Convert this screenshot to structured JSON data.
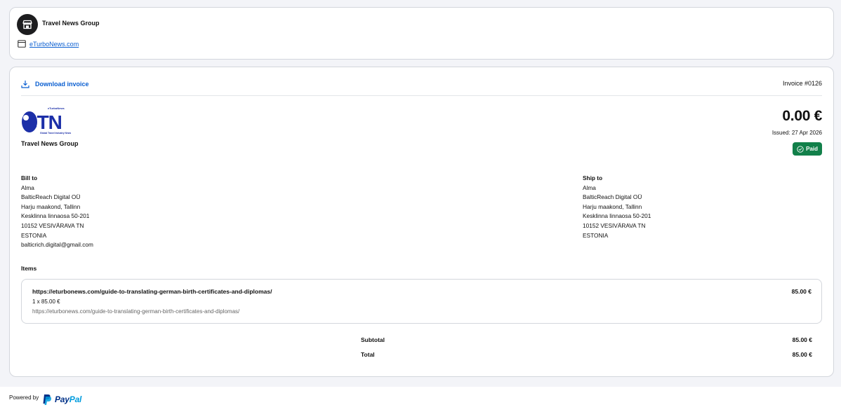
{
  "merchant": {
    "name": "Travel News Group",
    "website": "eTurboNews.com"
  },
  "invoice": {
    "download_label": "Download invoice",
    "number": "Invoice #0126",
    "logo_text": "eTN",
    "logo_top_text": "eTurboNews",
    "logo_tagline": "Global Travel Industry News",
    "company_name": "Travel News Group",
    "amount": "0.00 €",
    "issued": "Issued: 27 Apr 2026",
    "status": "Paid"
  },
  "bill_to": {
    "heading": "Bill to",
    "lines": [
      "Alma",
      "BalticReach Digital OÜ",
      "Harju maakond, Tallinn",
      "Kesklinna linnaosa 50-201",
      "10152 VESIVÄRAVA TN",
      "ESTONIA",
      "balticrich.digital@gmail.com"
    ]
  },
  "ship_to": {
    "heading": "Ship to",
    "lines": [
      "Alma",
      "BalticReach Digital OÜ",
      "Harju maakond, Tallinn",
      "Kesklinna linnaosa 50-201",
      "10152 VESIVÄRAVA TN",
      "ESTONIA"
    ]
  },
  "items": {
    "heading": "Items",
    "list": [
      {
        "title": "https://eturbonews.com/guide-to-translating-german-birth-certificates-and-diplomas/",
        "qty": "1 x 85.00 €",
        "description": "https://eturbonews.com/guide-to-translating-german-birth-certificates-and-diplomas/",
        "price": "85.00 €"
      }
    ]
  },
  "summary": {
    "subtotal_label": "Subtotal",
    "subtotal_value": "85.00 €",
    "total_label": "Total",
    "total_value": "85.00 €"
  },
  "footer": {
    "powered_by": "Powered by",
    "brand_pay": "Pay",
    "brand_pal": "Pal"
  },
  "colors": {
    "link": "#0b5fd1",
    "paid": "#12804a",
    "logo_blue": "#1c2fa8"
  },
  "icons": [
    "store-icon",
    "browser-window-icon",
    "download-icon",
    "check-circle-icon",
    "paypal-logo-icon"
  ]
}
